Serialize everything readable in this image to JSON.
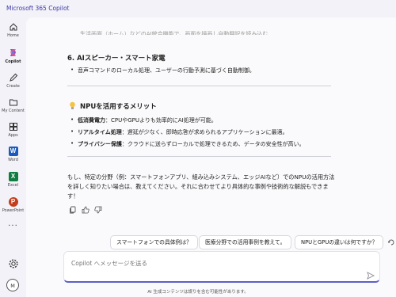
{
  "app": {
    "title": "Microsoft 365 Copilot"
  },
  "sidebar": {
    "items": [
      {
        "label": "Home",
        "icon": "home-icon"
      },
      {
        "label": "Copilot",
        "icon": "copilot-icon"
      },
      {
        "label": "Create",
        "icon": "pencil-icon"
      },
      {
        "label": "My Content",
        "icon": "folder-icon"
      },
      {
        "label": "Apps",
        "icon": "apps-icon"
      },
      {
        "label": "Word",
        "icon": "word-icon",
        "glyph": "W",
        "color": "#185abd"
      },
      {
        "label": "Excel",
        "icon": "excel-icon",
        "glyph": "X",
        "color": "#107c41"
      },
      {
        "label": "PowerPoint",
        "icon": "powerpoint-icon",
        "glyph": "P",
        "color": "#c43e1c"
      }
    ],
    "more": "···",
    "avatar": "M"
  },
  "content": {
    "clipped_text": "生活画面（ホーム）などのAI統合機能で、画面を描画し自動翻訳を読み込む",
    "section6_title": "6. AIスピーカー・スマート家電",
    "section6_bullet": "音声コマンドのローカル処理、ユーザーの行動予測に基づく自動制御。",
    "merits_title": "NPUを活用するメリット",
    "merits": [
      {
        "term": "低消費電力",
        "desc": "：CPUやGPUよりも効率的にAI処理が可能。"
      },
      {
        "term": "リアルタイム処理",
        "desc": "：遅延が少なく、即時応答が求められるアプリケーションに最適。"
      },
      {
        "term": "プライバシー保護",
        "desc": "：クラウドに送らずローカルで処理できるため、データの安全性が高い。"
      }
    ],
    "closing": "もし、特定の分野（例：スマートフォンアプリ、組み込みシステム、エッジAIなど）でのNPUの活用方法を詳しく知りたい場合は、教えてください。それに合わせてより具体的な事例や技術的な解説もできます！"
  },
  "suggestions": [
    "スマートフォンでの具体例は？",
    "医療分野での活用事例を教えて。",
    "NPUとGPUの違いは何ですか？"
  ],
  "composer": {
    "placeholder": "Copilot へメッセージを送る"
  },
  "disclaimer": "AI 生成コンテンツは誤りを含む可能性があります。"
}
